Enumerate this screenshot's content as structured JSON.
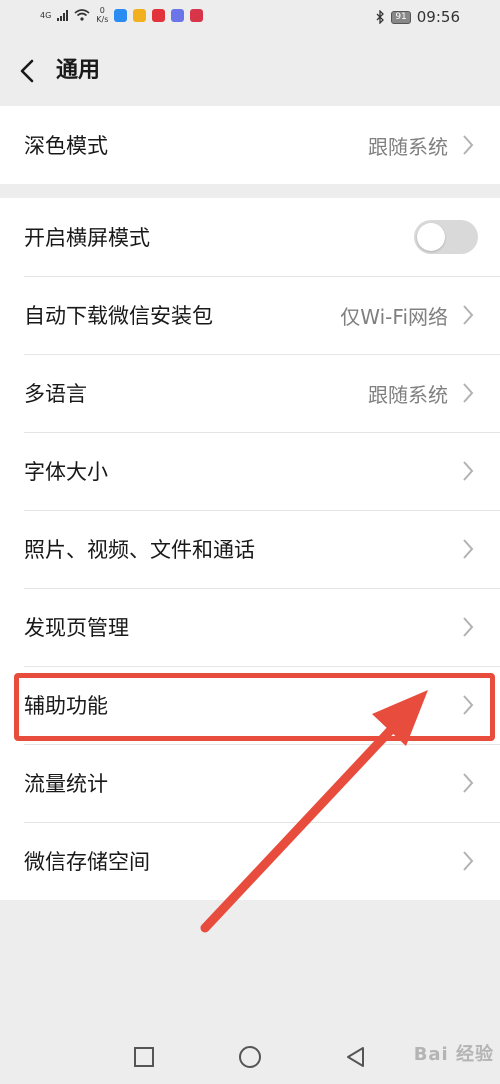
{
  "status_bar": {
    "network_type": "4G",
    "speed_value": "0",
    "speed_unit": "K/s",
    "battery": "91",
    "time": "09:56"
  },
  "header": {
    "title": "通用"
  },
  "groups": [
    {
      "items": [
        {
          "label": "深色模式",
          "value": "跟随系统"
        }
      ]
    },
    {
      "items": [
        {
          "label": "开启横屏模式",
          "toggle": "off"
        },
        {
          "label": "自动下载微信安装包",
          "value": "仅Wi-Fi网络"
        },
        {
          "label": "多语言",
          "value": "跟随系统"
        },
        {
          "label": "字体大小",
          "value": ""
        },
        {
          "label": "照片、视频、文件和通话",
          "value": ""
        },
        {
          "label": "发现页管理",
          "value": ""
        },
        {
          "label": "辅助功能",
          "value": ""
        },
        {
          "label": "流量统计",
          "value": ""
        },
        {
          "label": "微信存储空间",
          "value": ""
        }
      ]
    }
  ],
  "annotation": {
    "color": "#e84c3d"
  },
  "watermark": {
    "text": "Bai 经验"
  }
}
